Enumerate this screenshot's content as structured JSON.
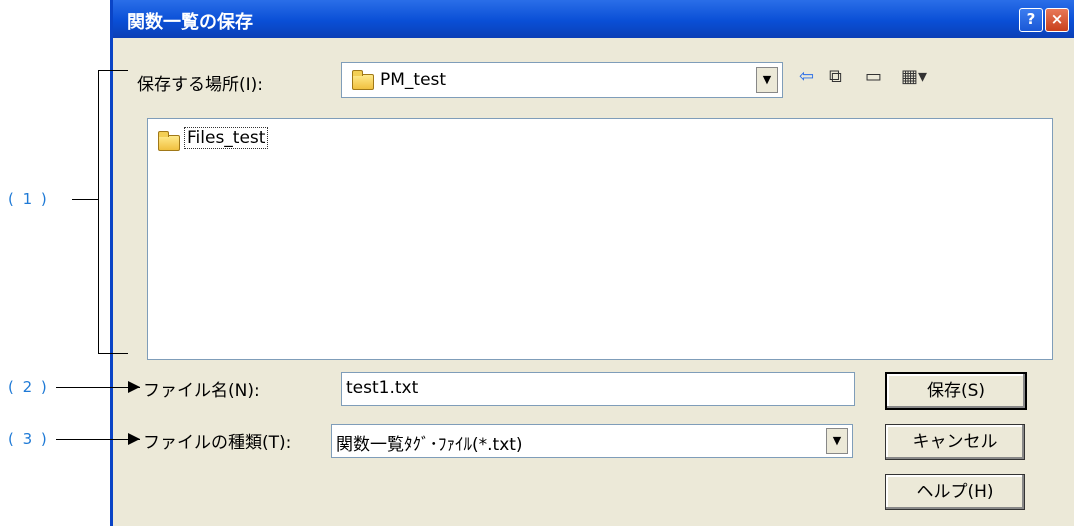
{
  "dialog": {
    "title": "関数一覧の保存",
    "help_button": "?",
    "close_button": "×"
  },
  "save_location": {
    "label": "保存する場所(I):",
    "value": "PM_test"
  },
  "toolbar": {
    "back_icon": "back-arrow-icon",
    "up_icon": "up-folder-icon",
    "new_folder_icon": "new-folder-icon",
    "view_icon": "view-menu-icon"
  },
  "file_list": {
    "items": [
      "Files_test"
    ]
  },
  "file_name": {
    "label": "ファイル名(N):",
    "value": "test1.txt"
  },
  "file_type": {
    "label": "ファイルの種類(T):",
    "value": "関数一覧ﾀｸﾞ･ﾌｧｲﾙ(*.txt)"
  },
  "buttons": {
    "save": "保存(S)",
    "cancel": "キャンセル",
    "help": "ヘルプ(H)"
  },
  "callouts": [
    "( 1 )",
    "( 2 )",
    "( 3 )"
  ]
}
